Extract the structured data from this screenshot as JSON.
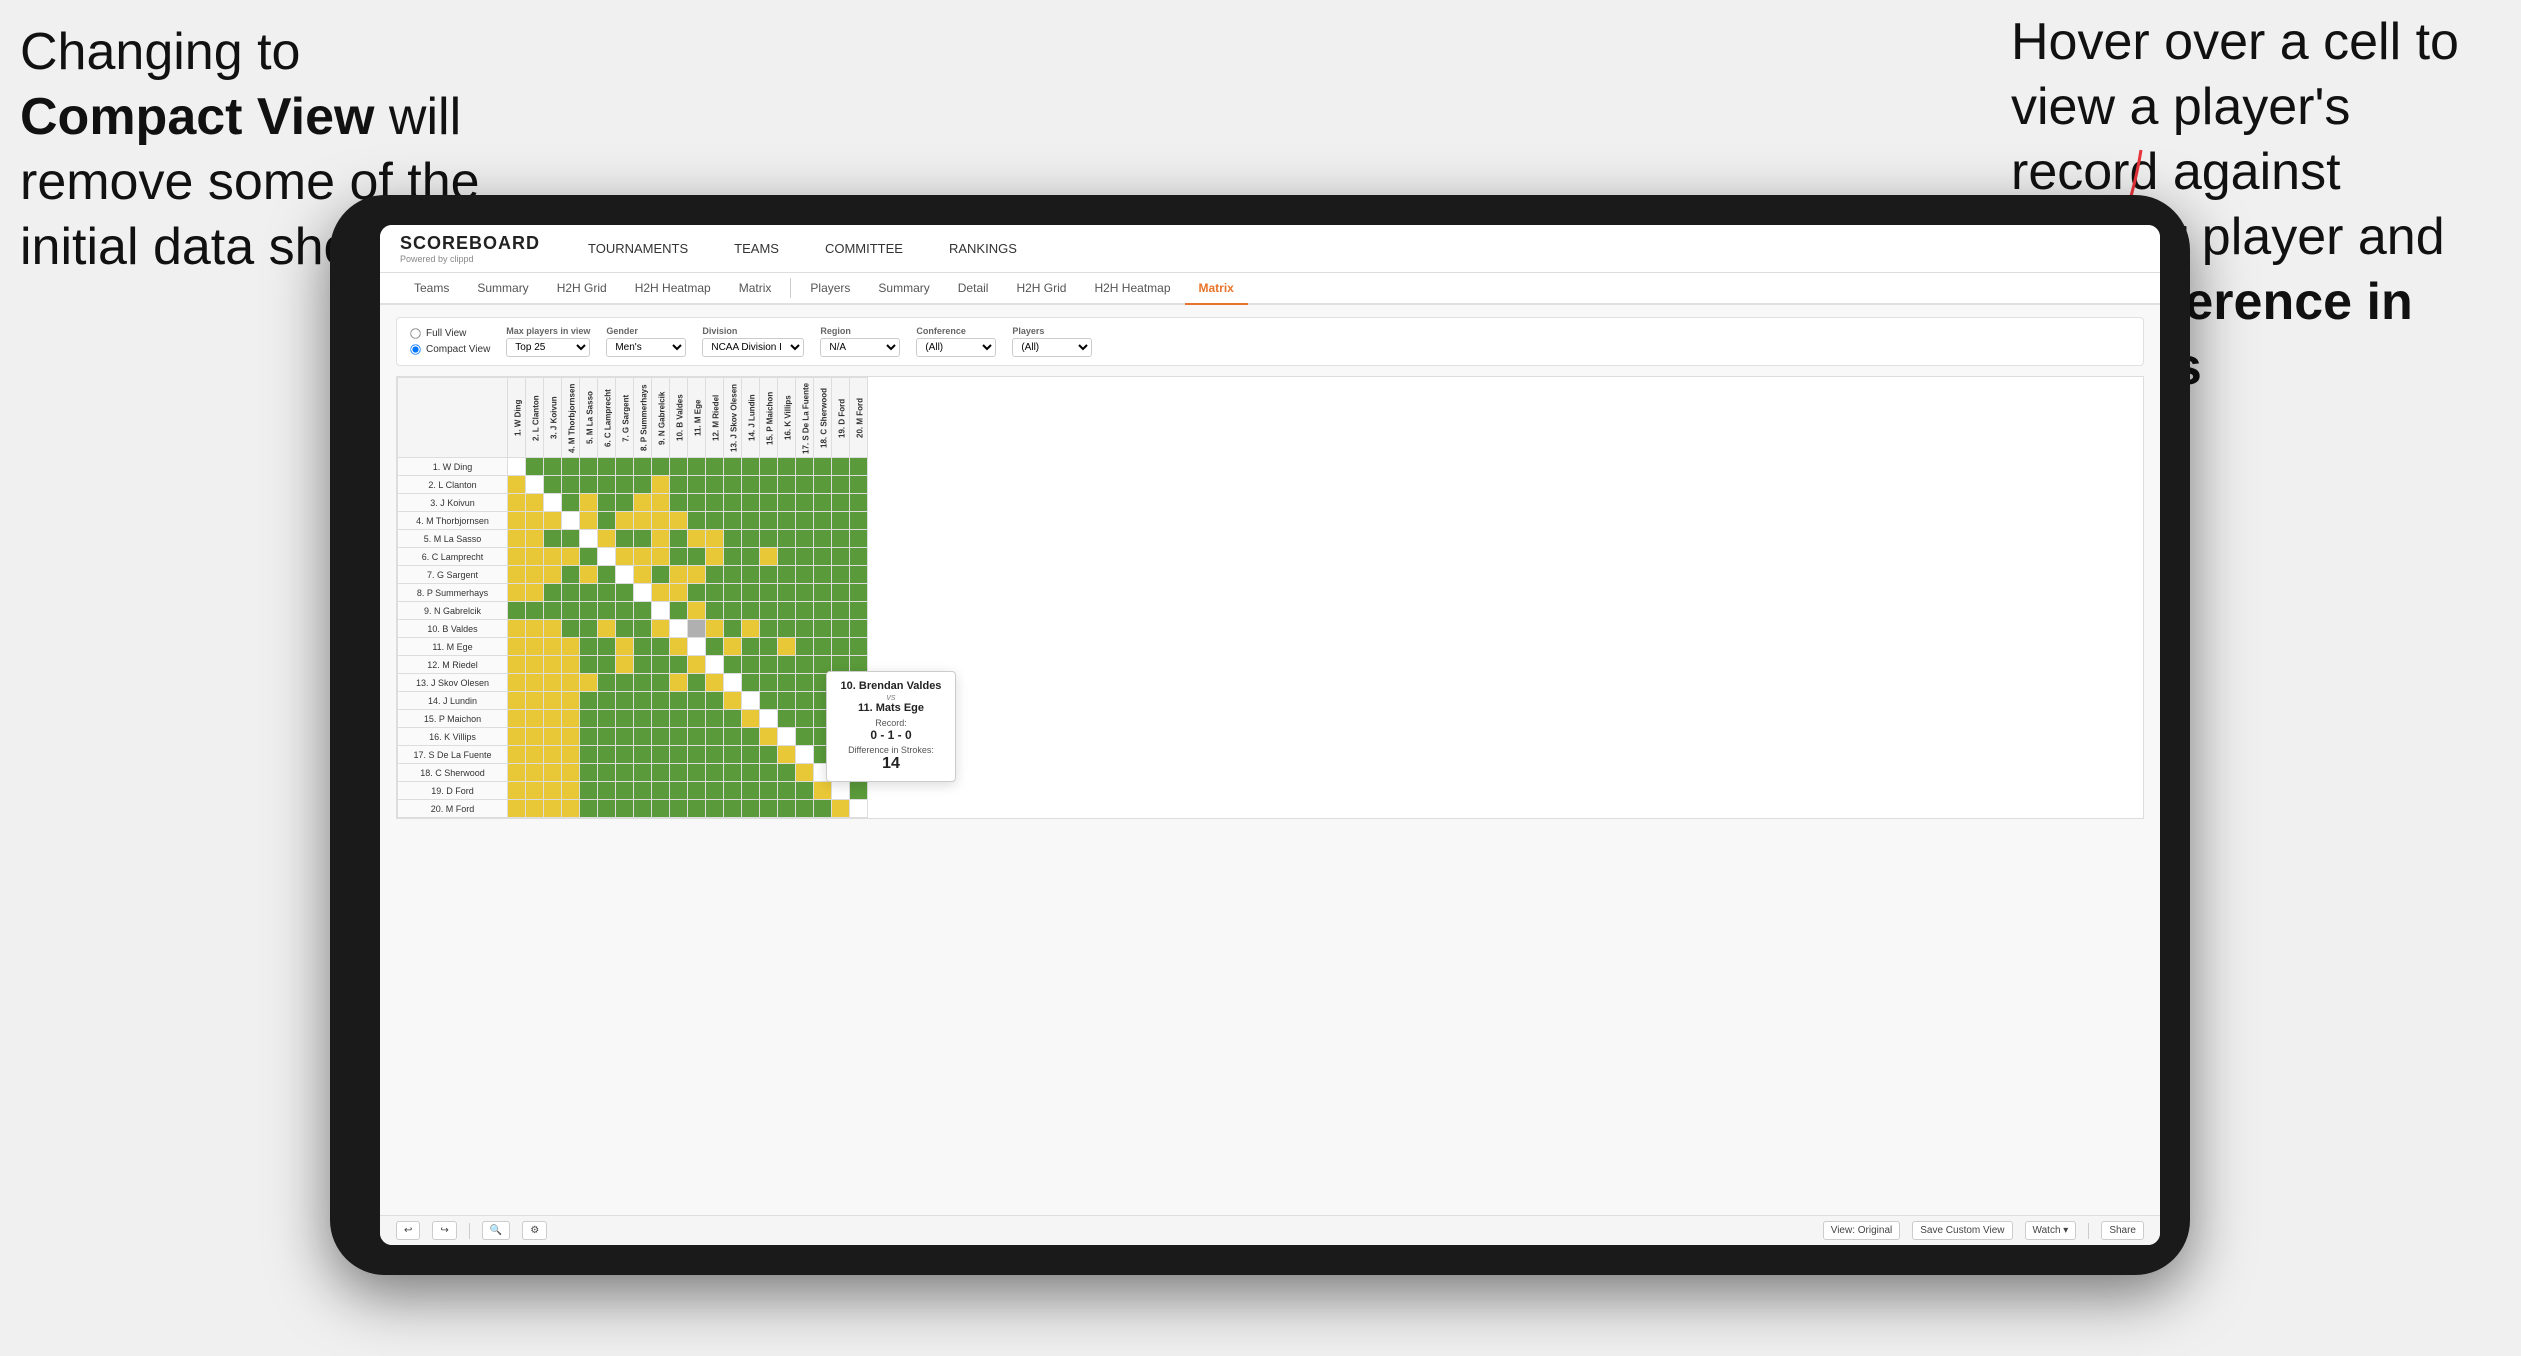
{
  "annotations": {
    "left_text_part1": "Changing to",
    "left_text_bold": "Compact View",
    "left_text_part2": " will remove some of the initial data shown",
    "right_text_part1": "Hover over a cell to view a player's record against another player and the ",
    "right_text_bold": "Difference in Strokes"
  },
  "nav": {
    "logo": "SCOREBOARD",
    "logo_sub": "Powered by clippd",
    "items": [
      "TOURNAMENTS",
      "TEAMS",
      "COMMITTEE",
      "RANKINGS"
    ]
  },
  "sub_nav": {
    "group1": [
      "Teams",
      "Summary",
      "H2H Grid",
      "H2H Heatmap",
      "Matrix"
    ],
    "group2": [
      "Players",
      "Summary",
      "Detail",
      "H2H Grid",
      "H2H Heatmap",
      "Matrix"
    ],
    "active": "Matrix"
  },
  "filters": {
    "view": {
      "options": [
        "Full View",
        "Compact View"
      ],
      "selected": "Compact View"
    },
    "max_players": {
      "label": "Max players in view",
      "value": "Top 25"
    },
    "gender": {
      "label": "Gender",
      "value": "Men's"
    },
    "division": {
      "label": "Division",
      "value": "NCAA Division I"
    },
    "region": {
      "label": "Region",
      "value": "N/A"
    },
    "conference": {
      "label": "Conference",
      "value": "(All)"
    },
    "players": {
      "label": "Players",
      "value": "(All)"
    }
  },
  "matrix": {
    "col_headers": [
      "1. W Ding",
      "2. L Clanton",
      "3. J Koivun",
      "4. M Thorbjornsen",
      "5. M La Sasso",
      "6. C Lamprecht",
      "7. G Sargent",
      "8. P Summerhays",
      "9. N Gabrelcik",
      "10. B Valdes",
      "11. M Ege",
      "12. M Riedel",
      "13. J Skov Olesen",
      "14. J Lundin",
      "15. P Maichon",
      "16. K Villips",
      "17. S De La Fuente",
      "18. C Sherwood",
      "19. D Ford",
      "20. M Ford"
    ],
    "rows": [
      {
        "label": "1. W Ding",
        "cells": [
          "self",
          "G",
          "G",
          "G",
          "G",
          "G",
          "G",
          "G",
          "G",
          "G",
          "G",
          "G",
          "G",
          "G",
          "G",
          "G",
          "G",
          "G",
          "G",
          "G"
        ]
      },
      {
        "label": "2. L Clanton",
        "cells": [
          "Y",
          "self",
          "G",
          "G",
          "G",
          "G",
          "G",
          "G",
          "Y",
          "G",
          "G",
          "G",
          "G",
          "G",
          "G",
          "G",
          "G",
          "G",
          "G",
          "G"
        ]
      },
      {
        "label": "3. J Koivun",
        "cells": [
          "Y",
          "Y",
          "self",
          "G",
          "Y",
          "G",
          "G",
          "Y",
          "Y",
          "G",
          "G",
          "G",
          "G",
          "G",
          "G",
          "G",
          "G",
          "G",
          "G",
          "G"
        ]
      },
      {
        "label": "4. M Thorbjornsen",
        "cells": [
          "Y",
          "Y",
          "Y",
          "self",
          "Y",
          "G",
          "Y",
          "Y",
          "Y",
          "Y",
          "G",
          "G",
          "G",
          "G",
          "G",
          "G",
          "G",
          "G",
          "G",
          "G"
        ]
      },
      {
        "label": "5. M La Sasso",
        "cells": [
          "Y",
          "Y",
          "G",
          "G",
          "self",
          "Y",
          "G",
          "G",
          "Y",
          "G",
          "Y",
          "Y",
          "G",
          "G",
          "G",
          "G",
          "G",
          "G",
          "G",
          "G"
        ]
      },
      {
        "label": "6. C Lamprecht",
        "cells": [
          "Y",
          "Y",
          "Y",
          "Y",
          "G",
          "self",
          "Y",
          "Y",
          "Y",
          "G",
          "G",
          "Y",
          "G",
          "G",
          "Y",
          "G",
          "G",
          "G",
          "G",
          "G"
        ]
      },
      {
        "label": "7. G Sargent",
        "cells": [
          "Y",
          "Y",
          "Y",
          "G",
          "Y",
          "G",
          "self",
          "Y",
          "G",
          "Y",
          "Y",
          "G",
          "G",
          "G",
          "G",
          "G",
          "G",
          "G",
          "G",
          "G"
        ]
      },
      {
        "label": "8. P Summerhays",
        "cells": [
          "Y",
          "Y",
          "G",
          "G",
          "G",
          "G",
          "G",
          "self",
          "Y",
          "Y",
          "G",
          "G",
          "G",
          "G",
          "G",
          "G",
          "G",
          "G",
          "G",
          "G"
        ]
      },
      {
        "label": "9. N Gabrelcik",
        "cells": [
          "G",
          "G",
          "G",
          "G",
          "G",
          "G",
          "G",
          "G",
          "self",
          "G",
          "Y",
          "G",
          "G",
          "G",
          "G",
          "G",
          "G",
          "G",
          "G",
          "G"
        ]
      },
      {
        "label": "10. B Valdes",
        "cells": [
          "Y",
          "Y",
          "Y",
          "G",
          "G",
          "Y",
          "G",
          "G",
          "Y",
          "self",
          "GR",
          "Y",
          "G",
          "Y",
          "G",
          "G",
          "G",
          "G",
          "G",
          "G"
        ]
      },
      {
        "label": "11. M Ege",
        "cells": [
          "Y",
          "Y",
          "Y",
          "Y",
          "G",
          "G",
          "Y",
          "G",
          "G",
          "Y",
          "self",
          "G",
          "Y",
          "G",
          "G",
          "Y",
          "G",
          "G",
          "G",
          "G"
        ]
      },
      {
        "label": "12. M Riedel",
        "cells": [
          "Y",
          "Y",
          "Y",
          "Y",
          "G",
          "G",
          "Y",
          "G",
          "G",
          "G",
          "Y",
          "self",
          "G",
          "G",
          "G",
          "G",
          "G",
          "G",
          "G",
          "G"
        ]
      },
      {
        "label": "13. J Skov Olesen",
        "cells": [
          "Y",
          "Y",
          "Y",
          "Y",
          "Y",
          "G",
          "G",
          "G",
          "G",
          "Y",
          "G",
          "Y",
          "self",
          "G",
          "G",
          "G",
          "G",
          "G",
          "G",
          "G"
        ]
      },
      {
        "label": "14. J Lundin",
        "cells": [
          "Y",
          "Y",
          "Y",
          "Y",
          "G",
          "G",
          "G",
          "G",
          "G",
          "G",
          "G",
          "G",
          "Y",
          "self",
          "G",
          "G",
          "G",
          "G",
          "G",
          "G"
        ]
      },
      {
        "label": "15. P Maichon",
        "cells": [
          "Y",
          "Y",
          "Y",
          "Y",
          "G",
          "G",
          "G",
          "G",
          "G",
          "G",
          "G",
          "G",
          "G",
          "Y",
          "self",
          "G",
          "G",
          "G",
          "G",
          "G"
        ]
      },
      {
        "label": "16. K Villips",
        "cells": [
          "Y",
          "Y",
          "Y",
          "Y",
          "G",
          "G",
          "G",
          "G",
          "G",
          "G",
          "G",
          "G",
          "G",
          "G",
          "Y",
          "self",
          "G",
          "G",
          "G",
          "G"
        ]
      },
      {
        "label": "17. S De La Fuente",
        "cells": [
          "Y",
          "Y",
          "Y",
          "Y",
          "G",
          "G",
          "G",
          "G",
          "G",
          "G",
          "G",
          "G",
          "G",
          "G",
          "G",
          "Y",
          "self",
          "G",
          "G",
          "G"
        ]
      },
      {
        "label": "18. C Sherwood",
        "cells": [
          "Y",
          "Y",
          "Y",
          "Y",
          "G",
          "G",
          "G",
          "G",
          "G",
          "G",
          "G",
          "G",
          "G",
          "G",
          "G",
          "G",
          "Y",
          "self",
          "G",
          "G"
        ]
      },
      {
        "label": "19. D Ford",
        "cells": [
          "Y",
          "Y",
          "Y",
          "Y",
          "G",
          "G",
          "G",
          "G",
          "G",
          "G",
          "G",
          "G",
          "G",
          "G",
          "G",
          "G",
          "G",
          "Y",
          "self",
          "G"
        ]
      },
      {
        "label": "20. M Ford",
        "cells": [
          "Y",
          "Y",
          "Y",
          "Y",
          "G",
          "G",
          "G",
          "G",
          "G",
          "G",
          "G",
          "G",
          "G",
          "G",
          "G",
          "G",
          "G",
          "G",
          "Y",
          "self"
        ]
      }
    ]
  },
  "tooltip": {
    "player1": "10. Brendan Valdes",
    "vs": "vs",
    "player2": "11. Mats Ege",
    "record_label": "Record:",
    "record": "0 - 1 - 0",
    "diff_label": "Difference in Strokes:",
    "diff": "14"
  },
  "toolbar": {
    "undo": "↩",
    "redo": "↪",
    "view_original": "View: Original",
    "save_custom": "Save Custom View",
    "watch": "Watch ▾",
    "share": "Share"
  }
}
